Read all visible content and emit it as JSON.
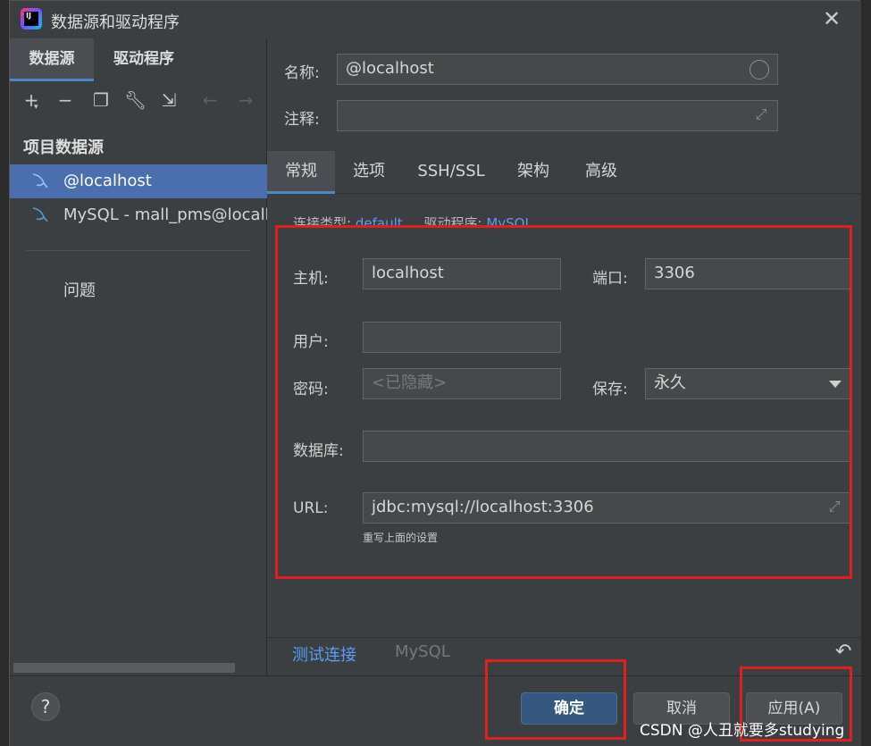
{
  "window": {
    "title": "数据源和驱动程序",
    "logo_text": "IJ"
  },
  "left_panel": {
    "tabs": [
      {
        "label": "数据源"
      },
      {
        "label": "驱动程序"
      }
    ],
    "toolbar_icons": [
      "add-icon",
      "remove-icon",
      "duplicate-icon",
      "wrench-icon",
      "import-icon",
      "back-arrow-icon",
      "forward-arrow-icon"
    ],
    "section_title": "项目数据源",
    "items": [
      {
        "label": "@localhost",
        "selected": true
      },
      {
        "label": "MySQL - mall_pms@localhost",
        "selected": false
      }
    ],
    "problems": "问题"
  },
  "form": {
    "name_label": "名称:",
    "name_value": "@localhost",
    "comment_label": "注释:",
    "comment_value": ""
  },
  "tabs": [
    {
      "label": "常规",
      "active": true
    },
    {
      "label": "选项"
    },
    {
      "label": "SSH/SSL"
    },
    {
      "label": "架构"
    },
    {
      "label": "高级"
    }
  ],
  "connection": {
    "type_label": "连接类型:",
    "type_value": "default",
    "driver_label": "驱动程序:",
    "driver_value": "MySQL"
  },
  "general": {
    "host_label": "主机:",
    "host_value": "localhost",
    "port_label": "端口:",
    "port_value": "3306",
    "user_label": "用户:",
    "user_value": "",
    "password_label": "密码:",
    "password_placeholder": "<已隐藏>",
    "save_label": "保存:",
    "save_value": "永久",
    "database_label": "数据库:",
    "database_value": "",
    "url_label": "URL:",
    "url_value": "jdbc:mysql://localhost:3306",
    "url_hint": "重写上面的设置"
  },
  "bottom": {
    "test_connection": "测试连接",
    "driver_tab": "MySQL"
  },
  "footer": {
    "help": "?",
    "ok": "确定",
    "cancel": "取消",
    "apply": "应用(A)"
  },
  "watermark": "CSDN @人丑就要多studying",
  "colors": {
    "accent": "#4a88c7",
    "selection": "#4b6eaf",
    "link": "#589df6",
    "highlight_box": "#e02020"
  }
}
